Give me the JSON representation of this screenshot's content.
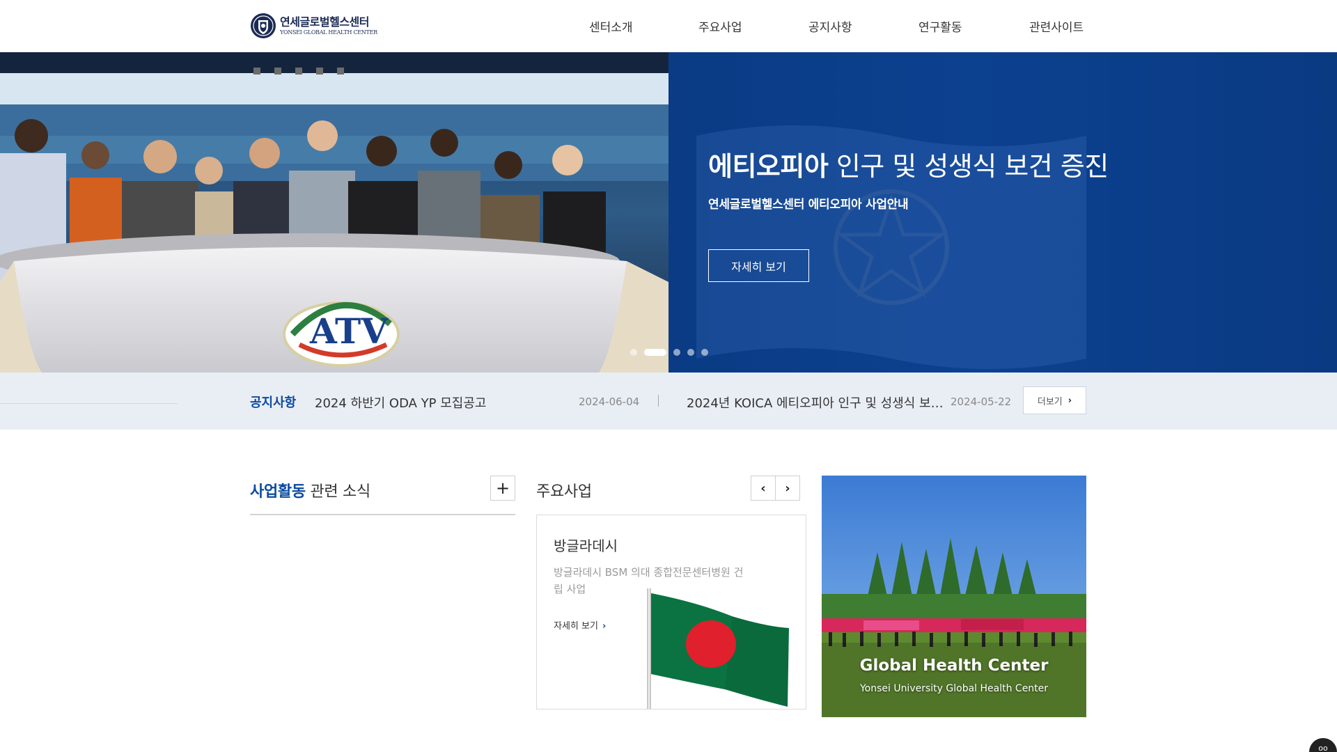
{
  "header": {
    "logo_ko": "연세글로벌헬스센터",
    "logo_en": "YONSEI GLOBAL HEALTH CENTER",
    "nav": [
      "센터소개",
      "주요사업",
      "공지사항",
      "연구활동",
      "관련사이트"
    ]
  },
  "hero": {
    "title_bold": "에티오피아",
    "title_rest": " 인구 및 성생식 보건 증진",
    "subtitle": "연세글로벌헬스센터 에티오피아 사업안내",
    "button": "자세히 보기",
    "backdrop_logo": "ATV",
    "slide_count": 5,
    "active_slide": 2
  },
  "notice": {
    "label": "공지사항",
    "items": [
      {
        "title": "2024 하반기 ODA YP 모집공고",
        "date": "2024-06-04"
      },
      {
        "title": "2024년 KOICA 에티오피아 인구 및 성생식 보…",
        "date": "2024-05-22"
      }
    ],
    "more": "더보기"
  },
  "news": {
    "title_bold": "사업활동",
    "title_rest": " 관련 소식",
    "plus": "+"
  },
  "projects": {
    "title": "주요사업",
    "prev": "‹",
    "next": "›",
    "card": {
      "title": "방글라데시",
      "desc": "방글라데시 BSM 의대 종합전문센터병원 건립 사업",
      "link": "자세히 보기"
    }
  },
  "promo": {
    "title": "Global Health Center",
    "subtitle": "Yonsei University Global Health Center"
  },
  "colors": {
    "brand_blue": "#0b4aa0",
    "hero_bg": "#0c3b80",
    "notice_bg": "#e9eef5"
  }
}
